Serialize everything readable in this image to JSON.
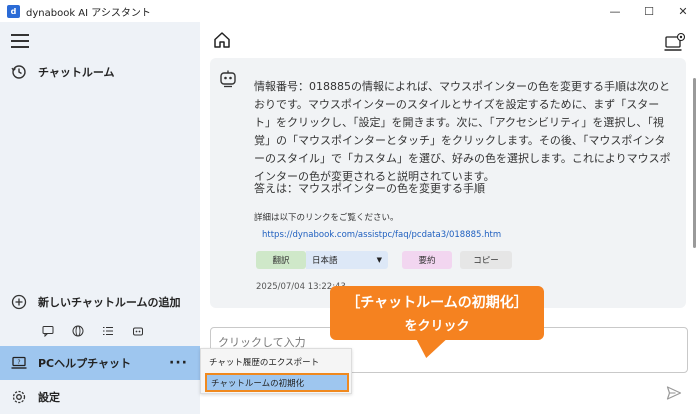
{
  "window": {
    "title": "dynabook AI アシスタント",
    "logo_text": "d",
    "controls": {
      "minimize": "—",
      "maximize": "☐",
      "close": "✕"
    }
  },
  "sidebar": {
    "chatroom_label": "チャットルーム",
    "new_chatroom_label": "新しいチャットルームの追加",
    "pc_help_label": "PCヘルプチャット",
    "more_label": "···",
    "settings_label": "設定"
  },
  "message": {
    "body": "情報番号：018885の情報によれば、マウスポインターの色を変更する手順は次のとおりです。マウスポインターのスタイルとサイズを設定するために、まず「スタート」をクリックし、「設定」を開きます。次に、「アクセシビリティ」を選択し、「視覚」の「マウスポインターとタッチ」をクリックします。その後、「マウスポインターのスタイル」で「カスタム」を選び、好みの色を選択します。これによりマウスポインターの色が変更されると説明されています。",
    "answer": "答えは：マウスポインターの色を変更する手順",
    "detail_intro": "詳細は以下のリンクをご覧ください。",
    "link": "https://dynabook.com/assistpc/faq/pcdata3/018885.htm",
    "translate_label": "翻訳",
    "language_value": "日本語",
    "summary_label": "要約",
    "copy_label": "コピー",
    "timestamp": "2025/07/04 13:22:43"
  },
  "input": {
    "placeholder": "クリックして入力"
  },
  "popup_menu": {
    "export_label": "チャット履歴のエクスポート",
    "reset_label": "チャットルームの初期化"
  },
  "callout": {
    "line1": "［チャットルームの初期化］",
    "line2": "をクリック"
  },
  "colors": {
    "accent": "#f58220",
    "selected": "#9ec6ef",
    "sidebar_bg": "#eef2f7"
  }
}
